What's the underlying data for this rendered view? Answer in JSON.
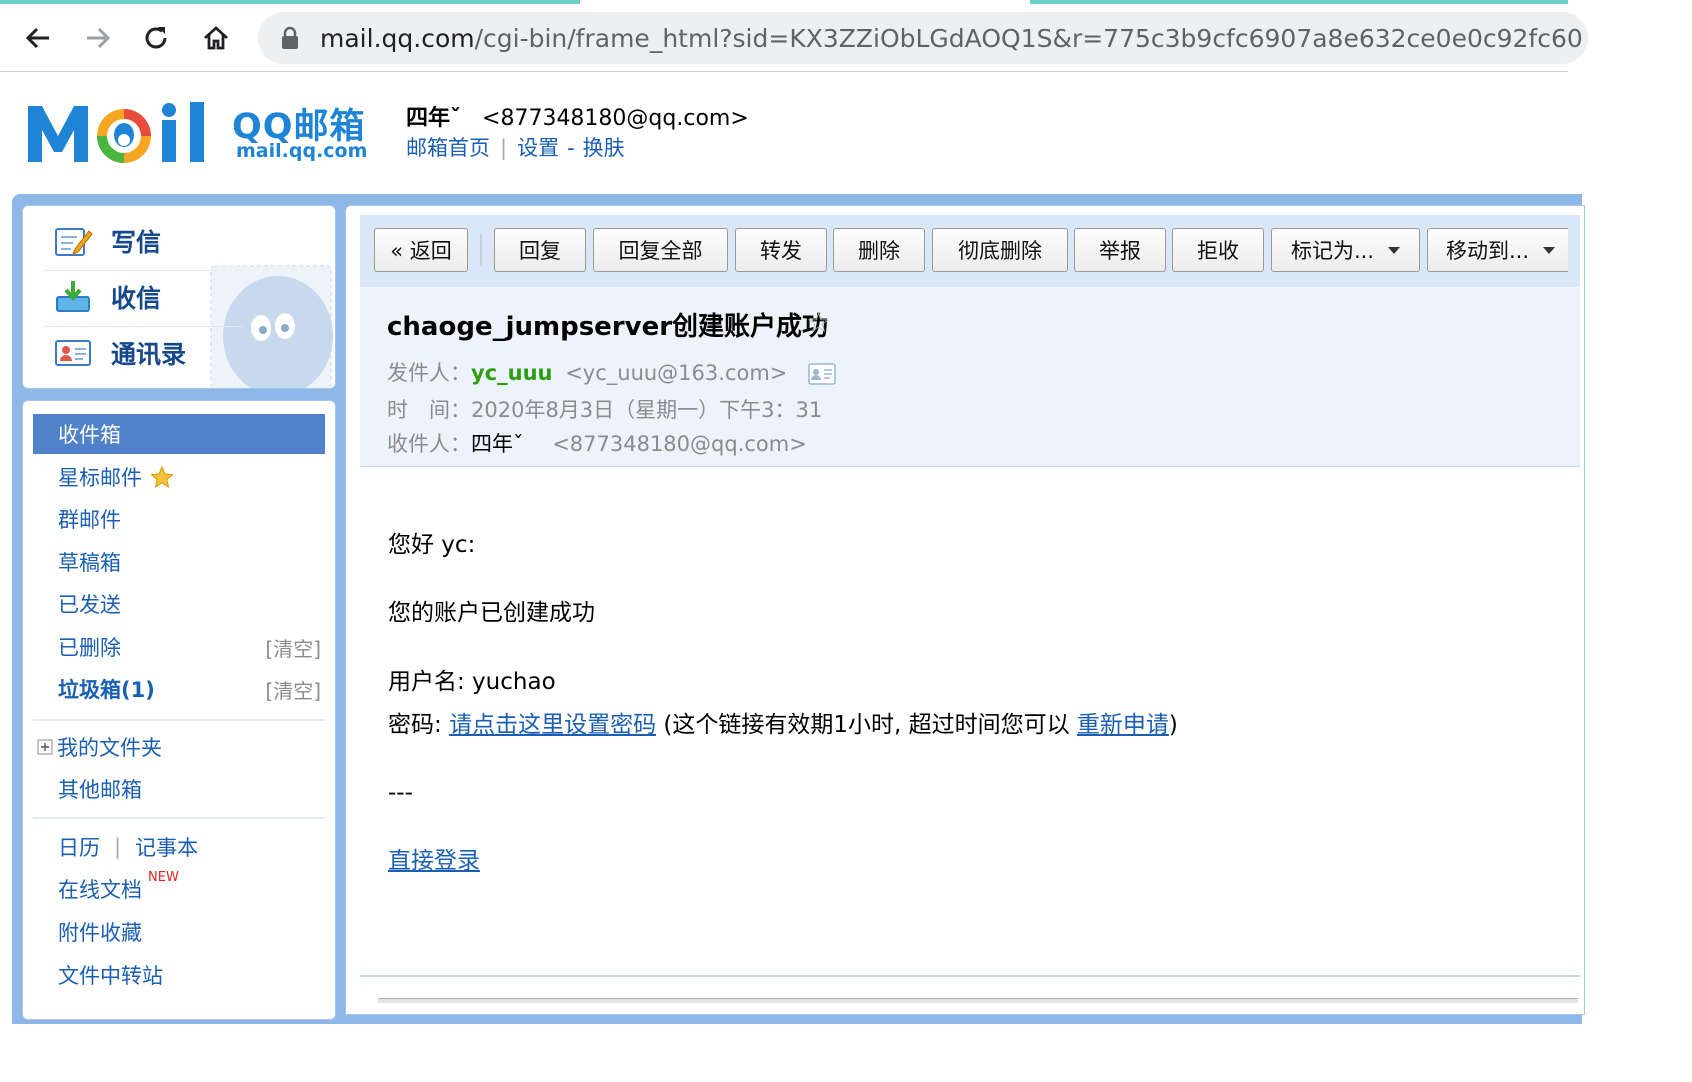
{
  "browser": {
    "url_host": "mail.qq.com",
    "url_path": "/cgi-bin/frame_html?sid=KX3ZZiObLGdAOQ1S&r=775c3b9cfc6907a8e632ce0e0c92fc60"
  },
  "header": {
    "logo_cn": "QQ邮箱",
    "logo_en": "mail.qq.com",
    "user_name": "四年ˇ",
    "user_email": "<877348180@qq.com>",
    "link_home": "邮箱首页",
    "link_settings": "设置",
    "link_skin": "换肤",
    "sep": "|",
    "dash": "-"
  },
  "sidebar": {
    "actions": [
      {
        "label": "写信"
      },
      {
        "label": "收信"
      },
      {
        "label": "通讯录"
      }
    ],
    "folders": [
      {
        "label": "收件箱"
      },
      {
        "label": "星标邮件"
      },
      {
        "label": "群邮件"
      },
      {
        "label": "草稿箱"
      },
      {
        "label": "已发送"
      },
      {
        "label": "已删除",
        "clear": "[清空]"
      },
      {
        "label": "垃圾箱(1)",
        "clear": "[清空]"
      }
    ],
    "my_folders": "我的文件夹",
    "other_mail": "其他邮箱",
    "calendar": "日历",
    "notepad": "记事本",
    "tools_sep": "|",
    "online_docs": "在线文档",
    "new_badge": "NEW",
    "attachments": "附件收藏",
    "transfer": "文件中转站"
  },
  "toolbar": {
    "back": "« 返回",
    "reply": "回复",
    "reply_all": "回复全部",
    "forward": "转发",
    "delete": "删除",
    "delete_perm": "彻底删除",
    "report": "举报",
    "reject": "拒收",
    "mark_as": "标记为...",
    "move_to": "移动到..."
  },
  "mail": {
    "subject": "chaoge_jumpserver创建账户成功",
    "from_label": "发件人：",
    "from_name": "yc_uuu",
    "from_email": "<yc_uuu@163.com>",
    "time_label": "时　间：",
    "time_value": "2020年8月3日（星期一）下午3：31",
    "to_label": "收件人：",
    "to_name": "四年ˇ",
    "to_email": "<877348180@qq.com>"
  },
  "body": {
    "greeting": "您好 yc:",
    "line1": "您的账户已创建成功",
    "username_line": "用户名: yuchao",
    "password_prefix": "密码: ",
    "password_link": "请点击这里设置密码",
    "password_note": " (这个链接有效期1小时, 超过时间您可以 ",
    "reapply_link": "重新申请",
    "close_paren": ")",
    "separator": "---",
    "login_link": "直接登录"
  },
  "colors": {
    "accent": "#1a5fb4",
    "active_folder": "#4f82c9",
    "frame": "#8db7e6",
    "sender_green": "#2d9e10"
  }
}
